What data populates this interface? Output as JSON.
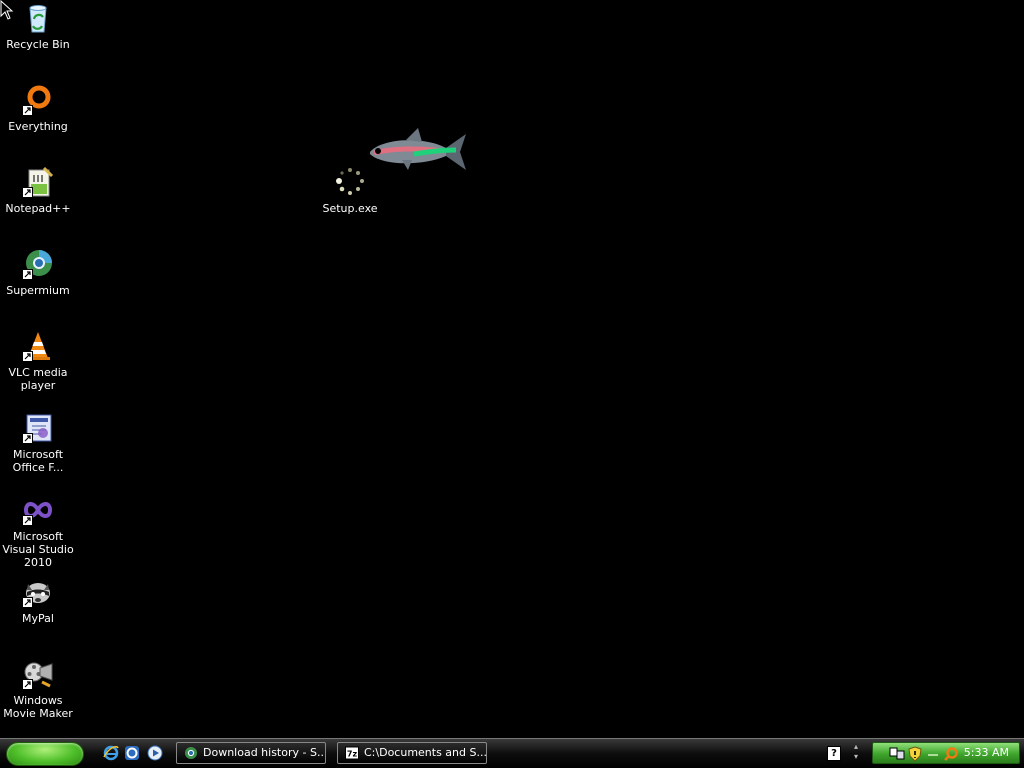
{
  "desktop": {
    "icons": [
      {
        "id": "recycle-bin",
        "label": "Recycle Bin",
        "icon": "recycle-bin-icon"
      },
      {
        "id": "everything",
        "label": "Everything",
        "icon": "everything-icon"
      },
      {
        "id": "notepad-plus-plus",
        "label": "Notepad++",
        "icon": "notepad-plus-plus-icon"
      },
      {
        "id": "supermium",
        "label": "Supermium",
        "icon": "supermium-icon"
      },
      {
        "id": "vlc",
        "label": "VLC media player",
        "icon": "vlc-cone-icon"
      },
      {
        "id": "ms-office-frontpage",
        "label": "Microsoft Office F...",
        "icon": "office-frontpage-icon"
      },
      {
        "id": "ms-visual-studio",
        "label": "Microsoft Visual Studio 2010",
        "icon": "visual-studio-icon"
      },
      {
        "id": "mypal",
        "label": "MyPal",
        "icon": "mypal-raccoon-icon"
      },
      {
        "id": "movie-maker",
        "label": "Windows Movie Maker",
        "icon": "movie-maker-icon"
      },
      {
        "id": "setup-exe",
        "label": "Setup.exe",
        "icon": "loading-spinner-icon"
      }
    ]
  },
  "taskbar": {
    "start_icon": "start-orb",
    "quick_launch": [
      "internet-explorer-icon",
      "ie-alt-icon",
      "media-player-icon"
    ],
    "tasks": [
      {
        "label": "Download history - S...",
        "icon": "supermium-icon"
      },
      {
        "label": "C:\\Documents and S...",
        "icon": "7zip-icon"
      }
    ],
    "help_label": "?",
    "tray_arrow": "▴\n▾",
    "tray_icons": [
      "network-icon",
      "security-shield-icon",
      "separator-icon",
      "everything-tray-icon"
    ],
    "clock": "5:33 AM"
  },
  "colors": {
    "desktop_bg": "#000000",
    "tray_green": "#3ea52b",
    "start_green": "#4fbf2a"
  }
}
